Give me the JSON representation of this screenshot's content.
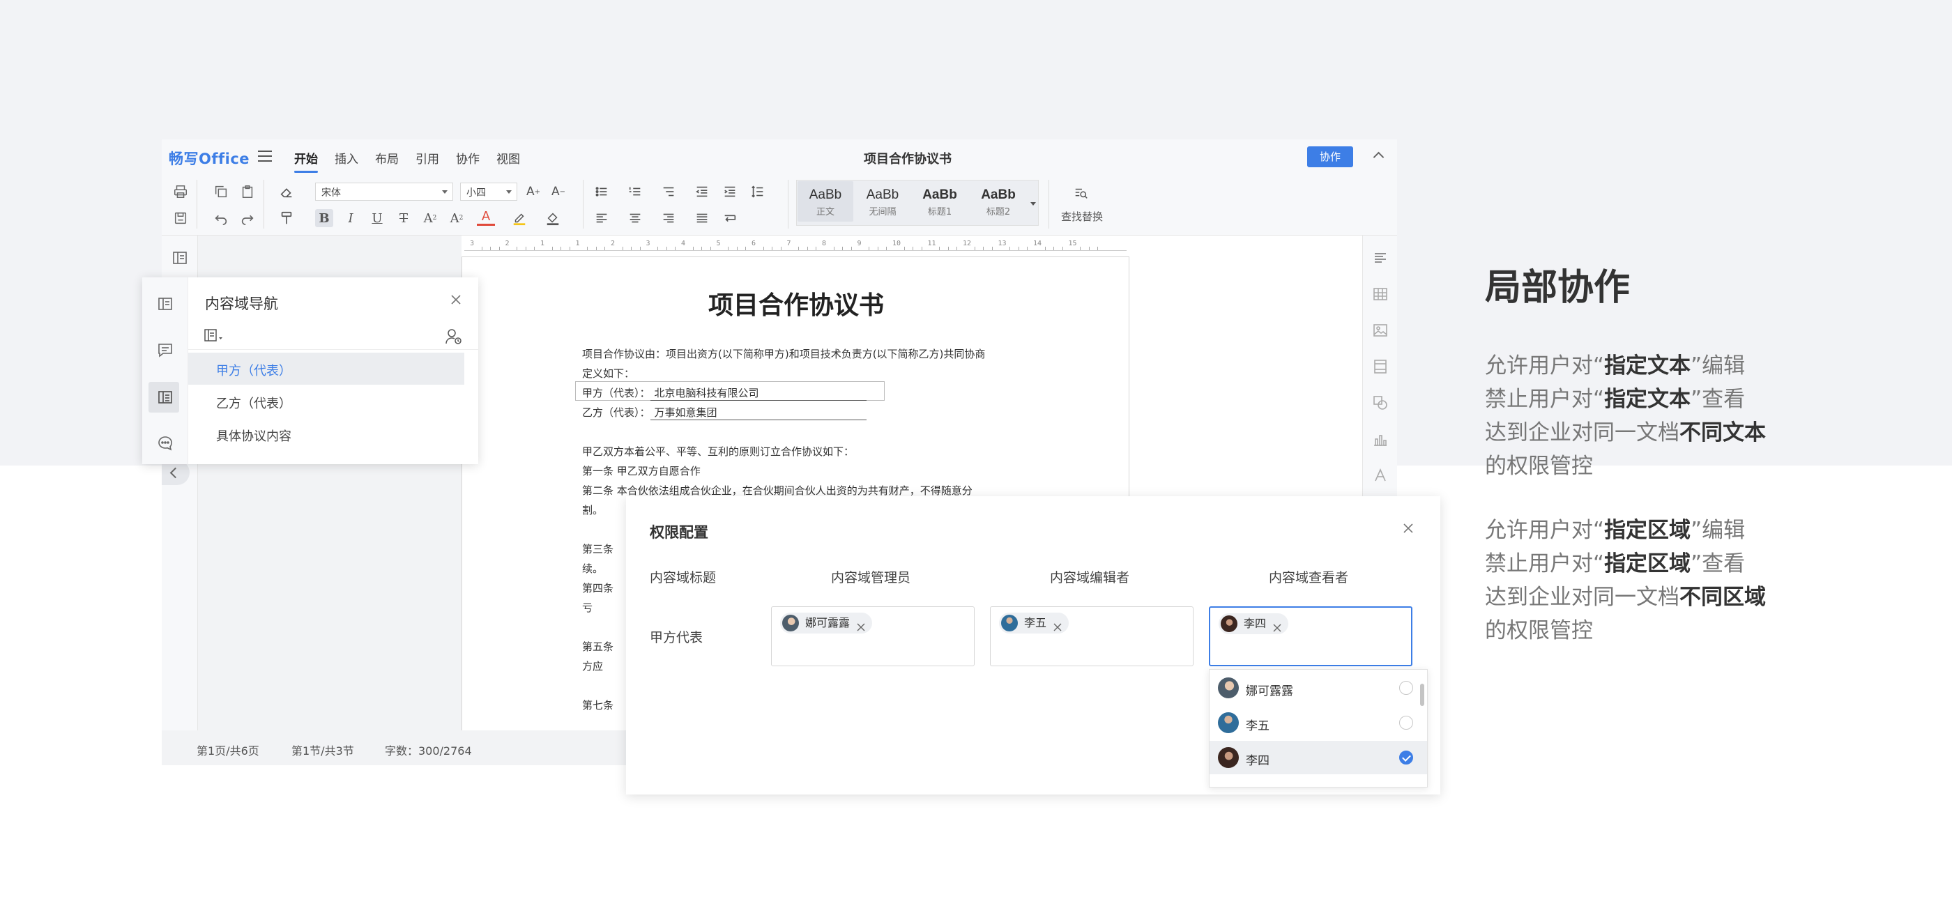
{
  "app": {
    "logo": "畅写Office",
    "menu": [
      "开始",
      "插入",
      "布局",
      "引用",
      "协作",
      "视图"
    ],
    "active_menu": "开始",
    "doc_title": "项目合作协议书",
    "collab_button": "协作"
  },
  "toolbar": {
    "font_name": "宋体",
    "font_size": "小四",
    "styles": [
      {
        "sample": "AaBb",
        "name": "正文"
      },
      {
        "sample": "AaBb",
        "name": "无间隔"
      },
      {
        "sample": "AaBb",
        "name": "标题1"
      },
      {
        "sample": "AaBb",
        "name": "标题2"
      }
    ],
    "find_replace": "查找替换"
  },
  "ruler": {
    "ticks": [
      "3",
      "2",
      "1",
      "1",
      "2",
      "3",
      "4",
      "5",
      "6",
      "7",
      "8",
      "9",
      "10",
      "11",
      "12",
      "13",
      "14",
      "15"
    ]
  },
  "document": {
    "heading": "项目合作协议书",
    "intro_1": "项目合作协议由：项目出资方(以下简称甲方)和项目技术负责方(以下简称乙方)共同协商",
    "intro_2": "定义如下：",
    "party_a_label": "甲方（代表）：",
    "party_a_value": "北京电脑科技有限公司",
    "party_b_label": "乙方（代表）：",
    "party_b_value": "万事如意集团",
    "p1": "甲乙双方本着公平、平等、互利的原则订立合作协议如下：",
    "p2": "第一条  甲乙双方自愿合作",
    "p3": "第二条  本合伙依法组成合伙企业，在合伙期间合伙人出资的为共有财产，不得随意分",
    "p4": "割。",
    "p5": "第三条",
    "p6": "续。",
    "p7": "第四条",
    "p8": "亏",
    "p9": "第五条",
    "p10": "方应",
    "p11": "第七条"
  },
  "statusbar": {
    "page": "第1页/共6页",
    "section": "第1节/共3节",
    "words": "字数：300/2764"
  },
  "nav_panel": {
    "title": "内容域导航",
    "items": [
      "甲方（代表）",
      "乙方（代表）",
      "具体协议内容"
    ],
    "active_index": 0
  },
  "permission_dialog": {
    "title": "权限配置",
    "columns": [
      "内容域标题",
      "内容域管理员",
      "内容域编辑者",
      "内容域查看者"
    ],
    "row_label": "甲方代表",
    "admin_chip": "娜可露露",
    "editor_chip": "李五",
    "viewer_chip": "李四",
    "dropdown_options": [
      {
        "name": "娜可露露",
        "checked": false
      },
      {
        "name": "李五",
        "checked": false
      },
      {
        "name": "李四",
        "checked": true
      }
    ]
  },
  "marketing": {
    "title": "局部协作",
    "para1_line1_a": "允许用户对“",
    "para1_line1_b": "指定文本",
    "para1_line1_c": "”编辑",
    "para1_line2_a": "禁止用户对“",
    "para1_line2_b": "指定文本",
    "para1_line2_c": "”查看",
    "para1_line3_a": "达到企业对同一文档",
    "para1_line3_b": "不同文本",
    "para1_line4": "的权限管控",
    "para2_line1_a": "允许用户对“",
    "para2_line1_b": "指定区域",
    "para2_line1_c": "”编辑",
    "para2_line2_a": "禁止用户对“",
    "para2_line2_b": "指定区域",
    "para2_line2_c": "”查看",
    "para2_line3_a": "达到企业对同一文档",
    "para2_line3_b": "不同区域",
    "para2_line4": "的权限管控"
  },
  "colors": {
    "accent": "#3d7ee6",
    "page_bg": "#f2f3f6"
  }
}
